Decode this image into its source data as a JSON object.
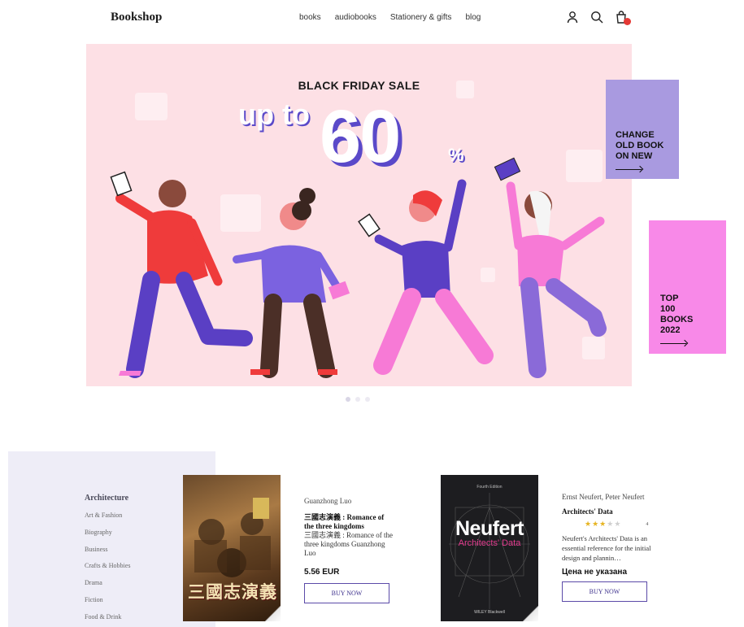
{
  "header": {
    "logo": "Bookshop",
    "nav": [
      "books",
      "audiobooks",
      "Stationery & gifts",
      "blog"
    ]
  },
  "banner": {
    "title": "BLACK FRIDAY SALE",
    "up_to": "up to",
    "percent": "60",
    "percent_sign": "%",
    "slides": 3,
    "active_slide": 1
  },
  "promos": [
    {
      "label": "CHANGE\nOLD BOOK\nON NEW",
      "color": "#a99ae0"
    },
    {
      "label": "TOP\n100\nBOOKS\n2022",
      "color": "#f889e8"
    }
  ],
  "categories": {
    "heading": "Architecture",
    "items": [
      "Art & Fashion",
      "Biography",
      "Business",
      "Crafts & Hobbies",
      "Drama",
      "Fiction",
      "Food & Drink"
    ]
  },
  "books": [
    {
      "author": "Guanzhong Luo",
      "title": "三國志演義 : Romance of the three kingdoms",
      "subtitle": "三國志演義 : Romance of the three kingdoms Guanzhong Luo",
      "price": "5.56 EUR",
      "buy_label": "BUY NOW",
      "cover_text": "三國志演義"
    },
    {
      "author": "Ernst Neufert, Peter Neufert",
      "title": "Architects' Data",
      "rating": 3,
      "rating_max": 5,
      "review_count": "4",
      "description": "Neufert's Architects' Data is an essential reference for the initial design and plannin…",
      "price_note": "Цена не указана",
      "buy_label": "BUY NOW",
      "cover": {
        "edition": "Fourth Edition",
        "title": "Neufert",
        "subtitle": "Architects' Data",
        "publisher": "WILEY Blackwell"
      }
    }
  ],
  "colors": {
    "accent": "#5a49c9",
    "banner_bg": "#fde0e5",
    "cart_badge": "#e53935"
  }
}
